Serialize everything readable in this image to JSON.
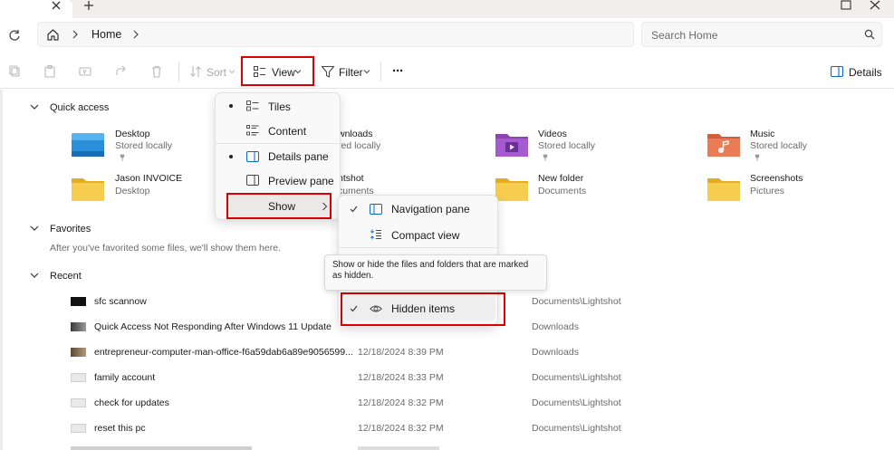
{
  "window": {
    "new_tab_glyph": "+",
    "close_tab_glyph": "×"
  },
  "address": {
    "breadcrumb_home": "Home",
    "search_placeholder": "Search Home"
  },
  "commandbar": {
    "sort_label": "Sort",
    "view_label": "View",
    "filter_label": "Filter",
    "more_label": "···",
    "details_label": "Details"
  },
  "quick_access": {
    "title": "Quick access",
    "items": [
      {
        "name": "Desktop",
        "sub": "Stored locally",
        "icon": "desktop-folder-icon"
      },
      {
        "name": "wnloads",
        "sub": "red locally",
        "icon": "downloads-folder-icon"
      },
      {
        "name": "Videos",
        "sub": "Stored locally",
        "icon": "videos-folder-icon"
      },
      {
        "name": "Music",
        "sub": "Stored locally",
        "icon": "music-folder-icon"
      },
      {
        "name": "Jason INVOICE",
        "sub": "Desktop",
        "icon": "folder-icon"
      },
      {
        "name": "ntshot",
        "sub": "cuments",
        "icon": "folder-icon"
      },
      {
        "name": "New folder",
        "sub": "Documents",
        "icon": "folder-icon"
      },
      {
        "name": "Screenshots",
        "sub": "Pictures",
        "icon": "folder-icon"
      }
    ]
  },
  "favorites": {
    "title": "Favorites",
    "hint": "After you've favorited some files, we'll show them here."
  },
  "recent": {
    "title": "Recent",
    "rows": [
      {
        "name": "sfc scannow",
        "date": "",
        "location": "Documents\\Lightshot"
      },
      {
        "name": "Quick Access Not Responding After Windows 11 Update",
        "date": "",
        "location": "Downloads"
      },
      {
        "name": "entrepreneur-computer-man-office-f6a59dab6a89e9056599...",
        "date": "12/18/2024 8:39 PM",
        "location": "Downloads"
      },
      {
        "name": "family account",
        "date": "12/18/2024 8:33 PM",
        "location": "Documents\\Lightshot"
      },
      {
        "name": "check for updates",
        "date": "12/18/2024 8:32 PM",
        "location": "Documents\\Lightshot"
      },
      {
        "name": "reset this pc",
        "date": "12/18/2024 8:32 PM",
        "location": "Documents\\Lightshot"
      }
    ]
  },
  "view_menu": {
    "items": [
      {
        "label": "Tiles",
        "selected": true
      },
      {
        "label": "Content",
        "selected": false
      },
      {
        "label": "Details pane",
        "selected": true
      },
      {
        "label": "Preview pane",
        "selected": false
      }
    ],
    "show_label": "Show"
  },
  "show_submenu": {
    "items": [
      {
        "label": "Navigation pane",
        "checked": true
      },
      {
        "label": "Compact view",
        "checked": false
      },
      {
        "label": "Hidden items",
        "checked": true
      }
    ]
  },
  "tooltip": {
    "text": "Show or hide the files and folders that are marked as hidden."
  },
  "colors": {
    "highlight_red": "#d90000",
    "folder_yellow": "#f4c542",
    "accent_blue": "#0a67c9"
  }
}
